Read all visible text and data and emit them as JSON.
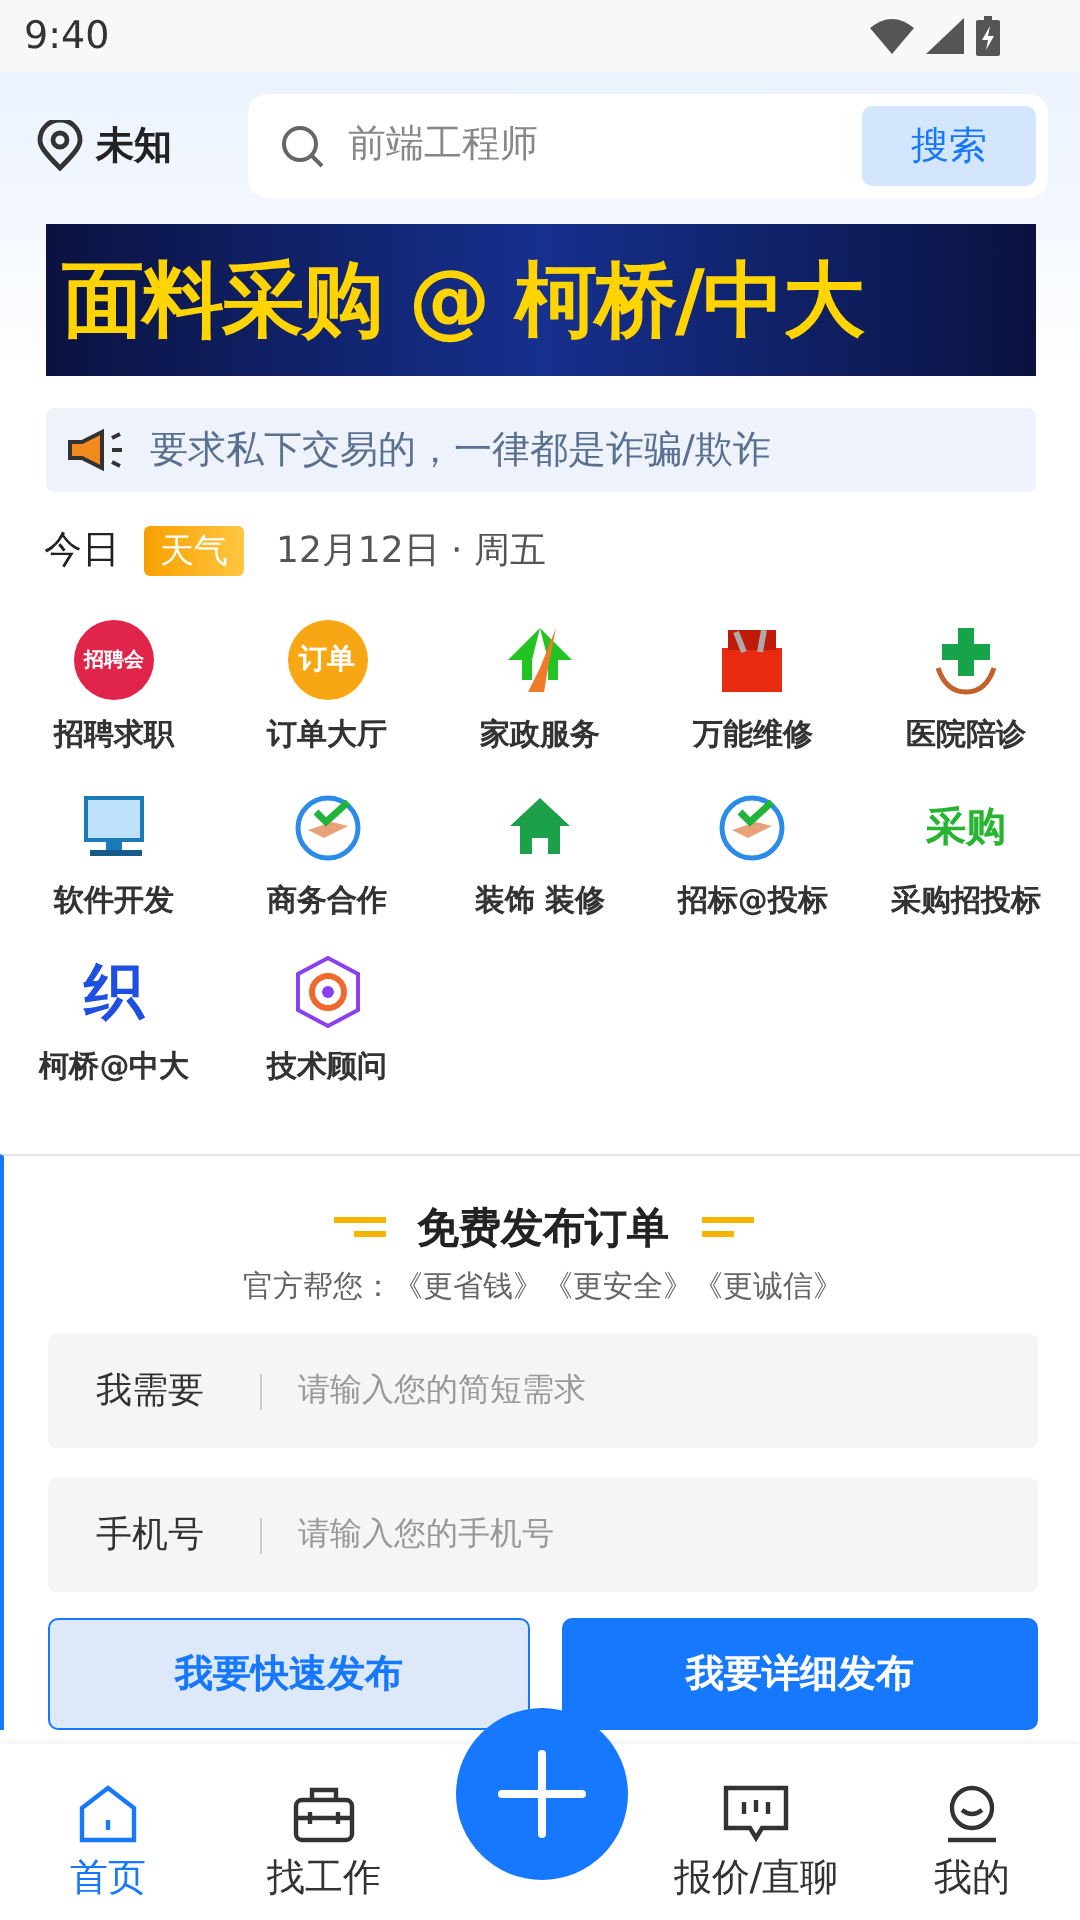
{
  "status_bar": {
    "time": "9:40"
  },
  "header": {
    "location": "未知",
    "search": {
      "placeholder": "前端工程师",
      "button": "搜索"
    }
  },
  "banner": {
    "title": "面料采购 @ 柯桥/中大"
  },
  "notice": {
    "text": "要求私下交易的，一律都是诈骗/欺诈"
  },
  "today": {
    "label": "今日",
    "badge": "天气",
    "date": "12月12日 · 周五"
  },
  "services": [
    {
      "label": "招聘求职",
      "kind": "badge",
      "icon_text": "招聘会",
      "color": "#e0244a"
    },
    {
      "label": "订单大厅",
      "kind": "badge",
      "icon_text": "订单",
      "color": "#f7a614"
    },
    {
      "label": "家政服务",
      "kind": "broom"
    },
    {
      "label": "万能维修",
      "kind": "toolbox"
    },
    {
      "label": "医院陪诊",
      "kind": "cross"
    },
    {
      "label": "软件开发",
      "kind": "monitor"
    },
    {
      "label": "商务合作",
      "kind": "handshake"
    },
    {
      "label": "装饰 装修",
      "kind": "house"
    },
    {
      "label": "招标@投标",
      "kind": "handshake"
    },
    {
      "label": "采购招投标",
      "kind": "word",
      "icon_text": "采购",
      "color": "#27b531"
    },
    {
      "label": "柯桥@中大",
      "kind": "word",
      "icon_text": "织",
      "color": "#1f4fe0"
    },
    {
      "label": "技术顾问",
      "kind": "hexagon"
    }
  ],
  "order_form": {
    "title": "免费发布订单",
    "subtitle": "官方帮您：《更省钱》《更安全》《更诚信》",
    "fields": [
      {
        "label": "我需要",
        "placeholder": "请输入您的简短需求"
      },
      {
        "label": "手机号",
        "placeholder": "请输入您的手机号"
      }
    ],
    "buttons": [
      {
        "label": "我要快速发布",
        "kind": "secondary"
      },
      {
        "label": "我要详细发布",
        "kind": "primary"
      }
    ]
  },
  "bottom_nav": [
    {
      "label": "首页",
      "kind": "home",
      "selected": true
    },
    {
      "label": "找工作",
      "kind": "briefcase",
      "selected": false
    },
    {
      "kind": "fab"
    },
    {
      "label": "报价/直聊",
      "kind": "chat",
      "selected": false
    },
    {
      "label": "我的",
      "kind": "user",
      "selected": false
    }
  ]
}
